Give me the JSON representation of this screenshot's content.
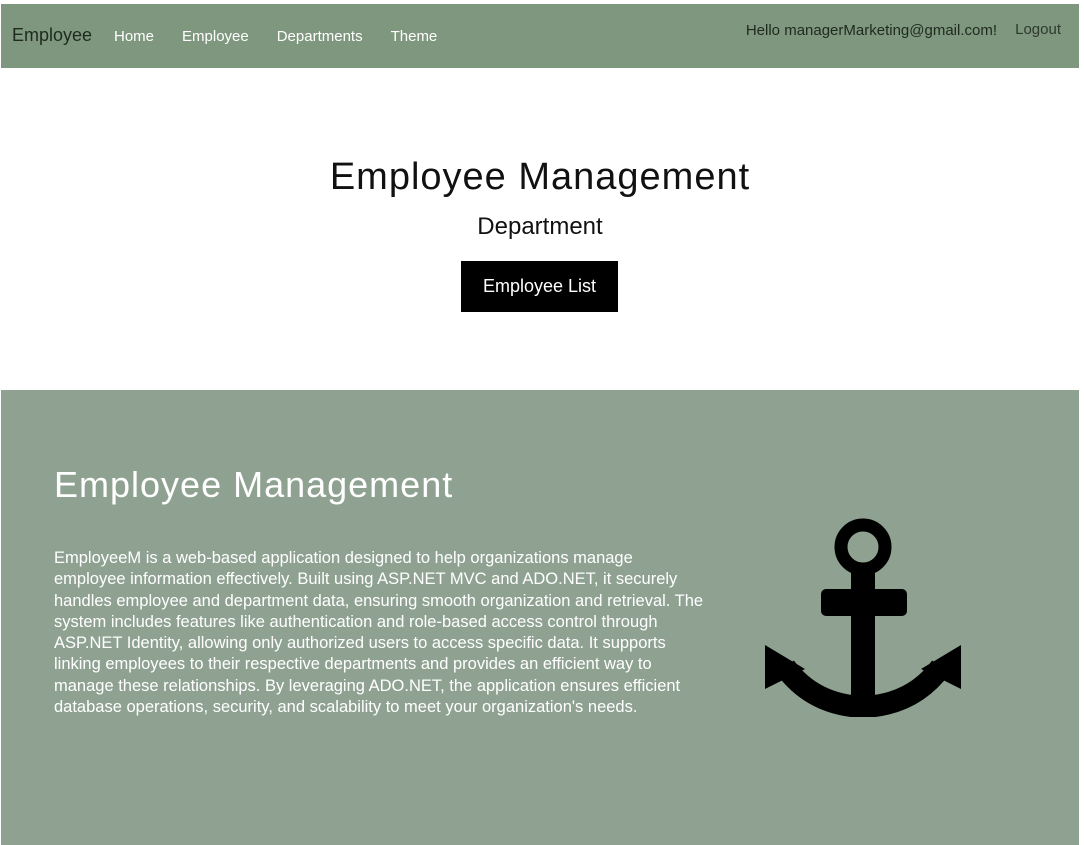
{
  "navbar": {
    "brand": "Employee",
    "links": [
      "Home",
      "Employee",
      "Departments",
      "Theme"
    ],
    "greeting": "Hello managerMarketing@gmail.com!",
    "logout": "Logout"
  },
  "hero": {
    "title": "Employee Management",
    "subtitle": "Department",
    "button": "Employee List"
  },
  "about": {
    "title": "Employee Management",
    "description": "EmployeeM is a web-based application designed to help organizations manage employee information effectively. Built using ASP.NET MVC and ADO.NET, it securely handles employee and department data, ensuring smooth organization and retrieval. The system includes features like authentication and role-based access control through ASP.NET Identity, allowing only authorized users to access specific data. It supports linking employees to their respective departments and provides an efficient way to manage these relationships. By leveraging ADO.NET, the application ensures efficient database operations, security, and scalability to meet your organization's needs.",
    "icon": "anchor-icon"
  },
  "colors": {
    "navbar_bg": "#7e977e",
    "about_bg": "#8fa292",
    "button_bg": "#000000"
  }
}
